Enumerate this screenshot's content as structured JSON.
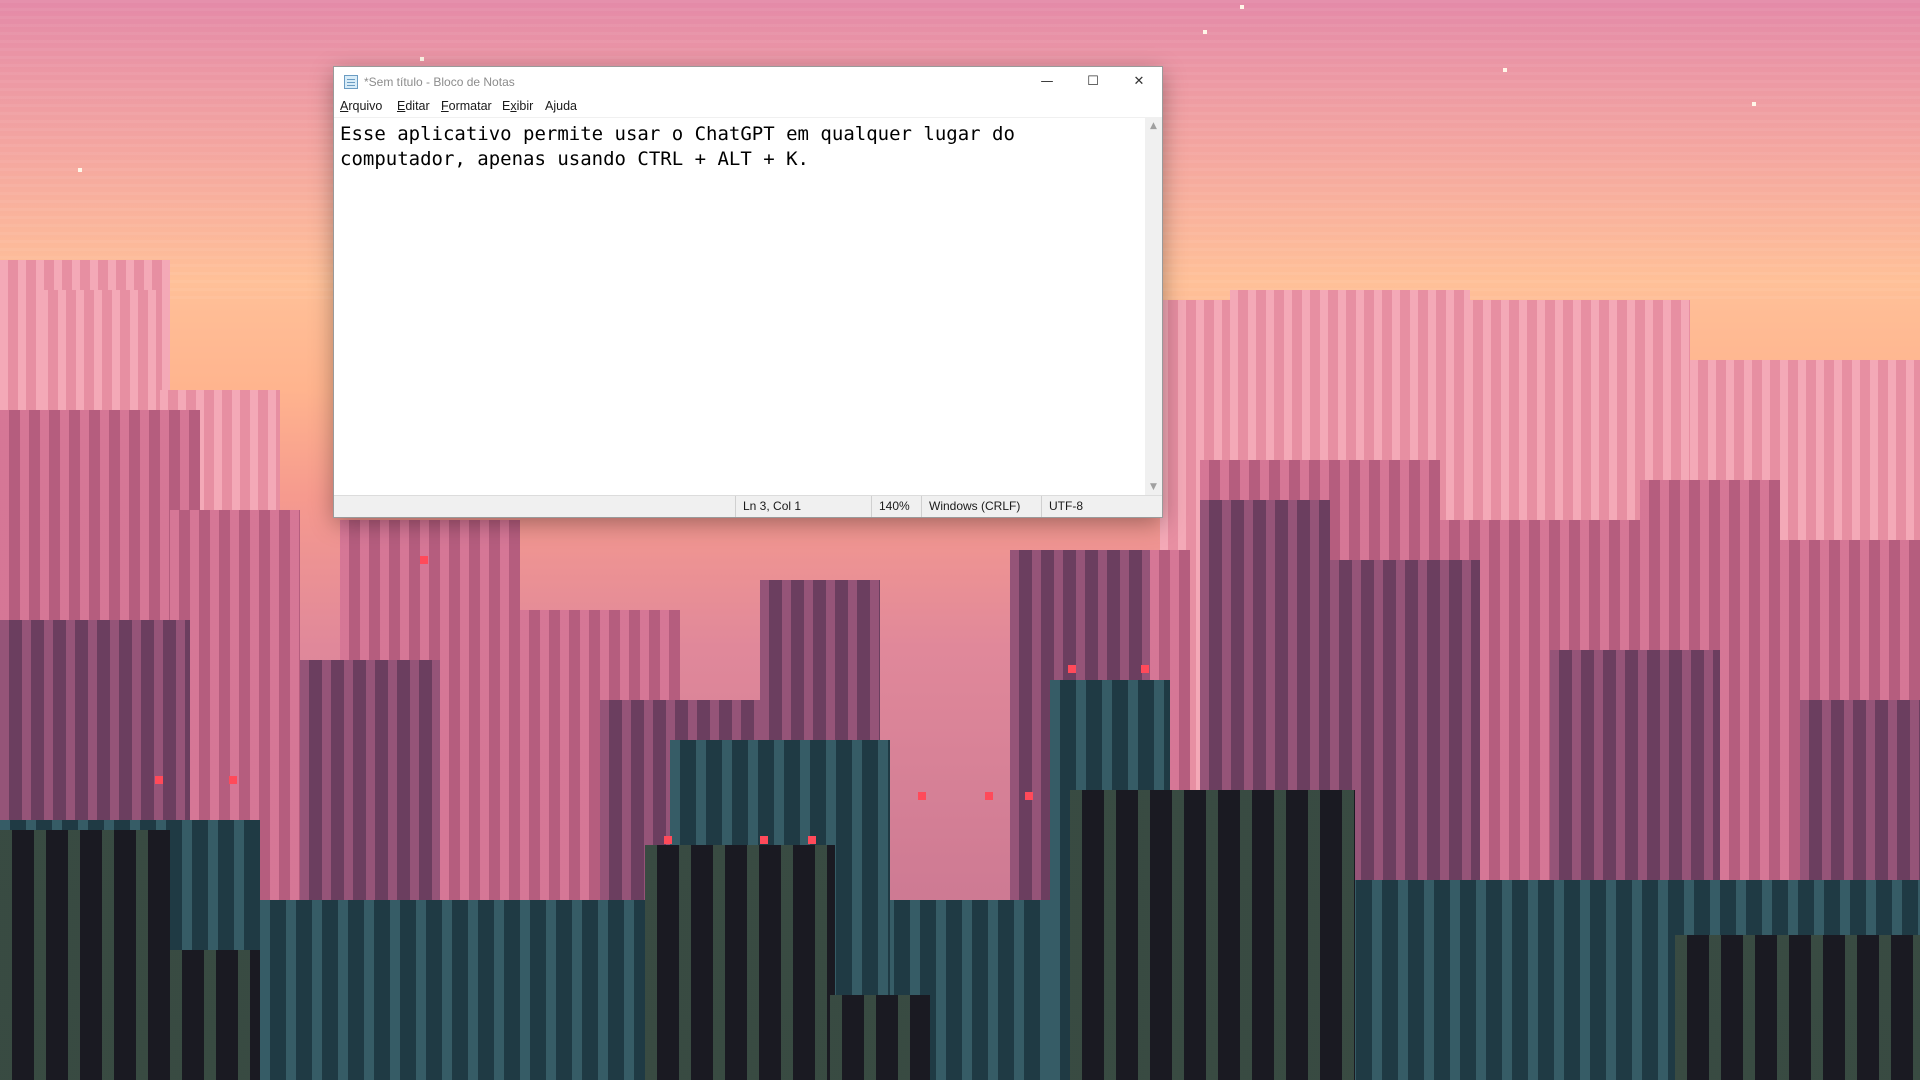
{
  "window": {
    "title": "*Sem título - Bloco de Notas",
    "icon": "notepad-icon",
    "controls": {
      "minimize": "—",
      "maximize": "☐",
      "close": "✕"
    }
  },
  "menu": {
    "items": [
      {
        "label": "Arquivo",
        "accesskey": "A"
      },
      {
        "label": "Editar",
        "accesskey": "E"
      },
      {
        "label": "Formatar",
        "accesskey": "F"
      },
      {
        "label": "Exibir",
        "accesskey": "x"
      },
      {
        "label": "Ajuda",
        "accesskey": "j"
      }
    ]
  },
  "editor": {
    "content": "Esse aplicativo permite usar o ChatGPT em qualquer lugar do\ncomputador, apenas usando CTRL + ALT + K."
  },
  "statusbar": {
    "position": "Ln 3, Col 1",
    "zoom": "140%",
    "line_ending": "Windows (CRLF)",
    "encoding": "UTF-8"
  },
  "desktop": {
    "wallpaper": "pixel-art city skyline at sunset",
    "colors": {
      "sky_top": "#e48aa8",
      "sky_mid": "#ffc098",
      "foreground": "#1a1a22"
    }
  }
}
